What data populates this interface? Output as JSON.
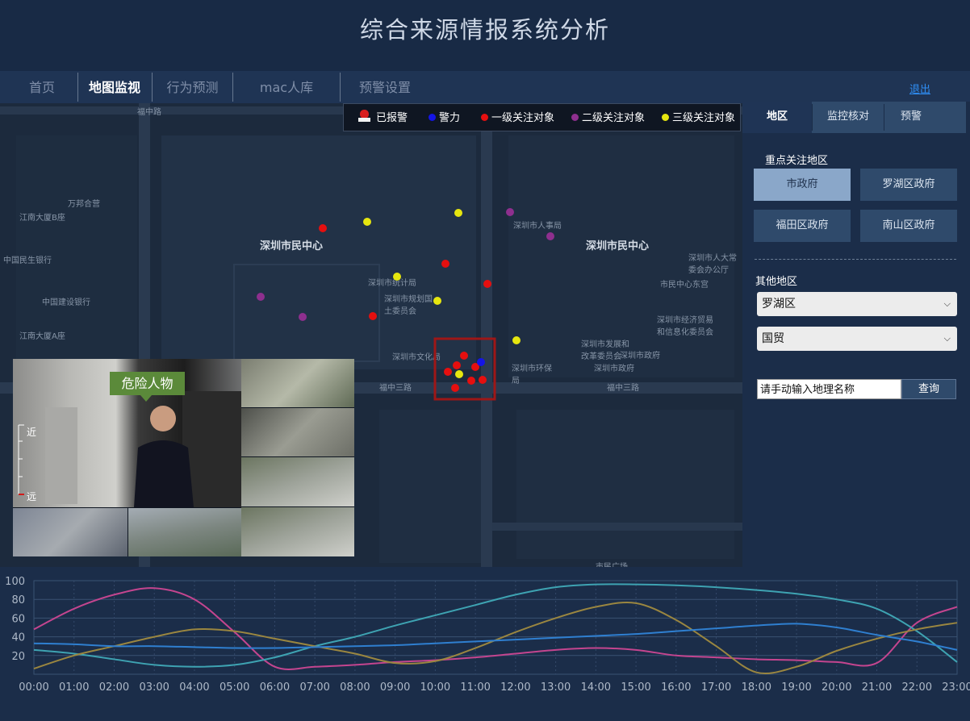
{
  "app": {
    "title": "综合来源情报系统分析"
  },
  "nav": {
    "items": [
      "首页",
      "地图监视",
      "行为预测",
      "mac人库",
      "预警设置"
    ],
    "active": "地图监视",
    "logout": "退出"
  },
  "legend": {
    "items": [
      {
        "label": "已报警",
        "icon": "alarm-light-icon",
        "color": "#d81e1e"
      },
      {
        "label": "警力",
        "color": "#1414e6"
      },
      {
        "label": "一级关注对象",
        "color": "#e50f0f"
      },
      {
        "label": "二级关注对象",
        "color": "#8e2f8e"
      },
      {
        "label": "三级关注对象",
        "color": "#e6e60f"
      }
    ]
  },
  "map": {
    "labels": [
      "深圳市民中心",
      "深圳市民中心",
      "福中三路",
      "福中三路",
      "福中路",
      "深圳市人大常委会办公厅",
      "深圳市政府",
      "市民广场",
      "万邦合营",
      "江南大厦B座",
      "中国民生银行",
      "中国建设银行",
      "江南大厦A座",
      "深圳市人事局",
      "深圳市统计局",
      "深圳市规划国土委员会",
      "市民中心东宫",
      "深圳市经济贸易和信息化委员会",
      "深圳市发展和改革委员会",
      "深圳市文化局",
      "深圳市环保局",
      "深圳市政府"
    ]
  },
  "panel": {
    "tabs": [
      "地区",
      "监控核对",
      "预警"
    ],
    "active_tab": "地区",
    "key_area_title": "重点关注地区",
    "key_areas": [
      "市政府",
      "罗湖区政府",
      "福田区政府",
      "南山区政府"
    ],
    "active_key_area": "市政府",
    "other_area_title": "其他地区",
    "district_select": "罗湖区",
    "area_select": "国贸",
    "search_placeholder": "请手动输入地理名称",
    "search_button": "查询"
  },
  "video": {
    "danger_label": "危险人物",
    "scale_near": "近",
    "scale_far": "远"
  },
  "chart_data": {
    "type": "line",
    "x": [
      "00:00",
      "01:00",
      "02:00",
      "03:00",
      "04:00",
      "05:00",
      "06:00",
      "07:00",
      "08:00",
      "09:00",
      "10:00",
      "11:00",
      "12:00",
      "13:00",
      "14:00",
      "15:00",
      "16:00",
      "17:00",
      "18:00",
      "19:00",
      "20:00",
      "21:00",
      "22:00",
      "23:00"
    ],
    "ylim": [
      0,
      100
    ],
    "yticks": [
      20,
      40,
      60,
      80,
      100
    ],
    "grid": true,
    "series": [
      {
        "color": "#c4458f",
        "values": [
          48,
          70,
          85,
          92,
          80,
          45,
          8,
          8,
          10,
          13,
          15,
          18,
          22,
          26,
          28,
          26,
          20,
          18,
          16,
          15,
          13,
          12,
          55,
          72
        ]
      },
      {
        "color": "#3ea3b2",
        "values": [
          26,
          22,
          16,
          10,
          8,
          10,
          18,
          30,
          40,
          52,
          63,
          74,
          85,
          93,
          96,
          96,
          95,
          93,
          90,
          86,
          80,
          70,
          46,
          13
        ]
      },
      {
        "color": "#9a8640",
        "values": [
          6,
          20,
          30,
          40,
          48,
          46,
          38,
          30,
          22,
          12,
          14,
          28,
          45,
          60,
          72,
          76,
          58,
          30,
          2,
          8,
          25,
          38,
          48,
          55
        ]
      },
      {
        "color": "#2f7fd0",
        "values": [
          33,
          32,
          30,
          30,
          29,
          28,
          28,
          29,
          30,
          31,
          33,
          35,
          37,
          39,
          41,
          43,
          46,
          49,
          52,
          54,
          50,
          42,
          35,
          26
        ]
      }
    ]
  }
}
